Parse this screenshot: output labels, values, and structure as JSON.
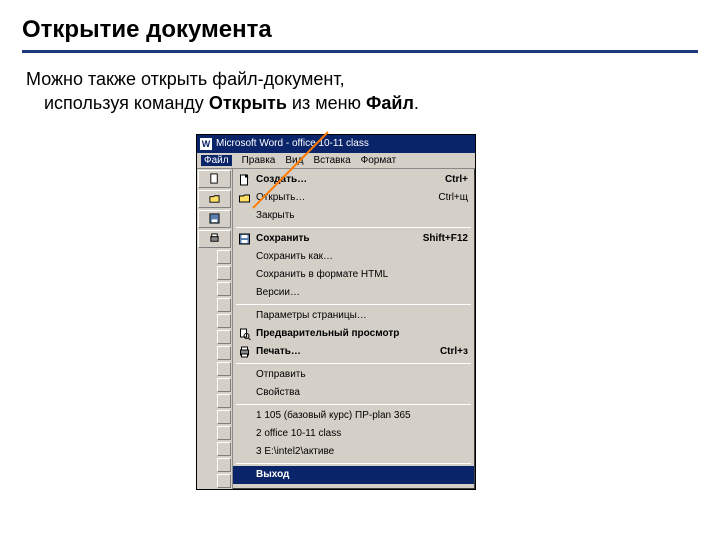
{
  "title": "Открытие документа",
  "para_line1": "Можно также открыть файл-документ,",
  "para_indent": "используя команду ",
  "para_bold1": "Открыть",
  "para_mid": " из меню ",
  "para_bold2": "Файл",
  "para_end": ".",
  "window": {
    "app_title": "Microsoft Word - office 10-11 class",
    "menubar": [
      "Файл",
      "Правка",
      "Вид",
      "Вставка",
      "Формат"
    ]
  },
  "menu": [
    {
      "icon": "new",
      "label": "Создать…",
      "shortcut": "Ctrl+",
      "bold": true
    },
    {
      "icon": "open",
      "label": "Открыть…",
      "shortcut": "Ctrl+щ",
      "bold": false
    },
    {
      "icon": "",
      "label": "Закрыть",
      "shortcut": "",
      "bold": false
    },
    {
      "sep": true
    },
    {
      "icon": "save",
      "label": "Сохранить",
      "shortcut": "Shift+F12",
      "bold": true
    },
    {
      "icon": "",
      "label": "Сохранить как…",
      "shortcut": "",
      "bold": false
    },
    {
      "icon": "",
      "label": "Сохранить в формате HTML",
      "shortcut": "",
      "bold": false
    },
    {
      "icon": "",
      "label": "Версии…",
      "shortcut": "",
      "bold": false
    },
    {
      "sep": true
    },
    {
      "icon": "",
      "label": "Параметры страницы…",
      "shortcut": "",
      "bold": false
    },
    {
      "icon": "preview",
      "label": "Предварительный просмотр",
      "shortcut": "",
      "bold": true
    },
    {
      "icon": "print",
      "label": "Печать…",
      "shortcut": "Ctrl+з",
      "bold": true
    },
    {
      "sep": true
    },
    {
      "icon": "",
      "label": "Отправить",
      "shortcut": "",
      "bold": false
    },
    {
      "icon": "",
      "label": "Свойства",
      "shortcut": "",
      "bold": false
    },
    {
      "sep": true
    },
    {
      "icon": "",
      "label": "1 105 (базовый курс) ПР-plan 365",
      "shortcut": "",
      "bold": false
    },
    {
      "icon": "",
      "label": "2 office 10-11 class",
      "shortcut": "",
      "bold": false
    },
    {
      "icon": "",
      "label": "3 E:\\intel2\\активе",
      "shortcut": "",
      "bold": false
    },
    {
      "sep": true
    },
    {
      "icon": "",
      "label": "Выход",
      "shortcut": "",
      "bold": true
    }
  ]
}
